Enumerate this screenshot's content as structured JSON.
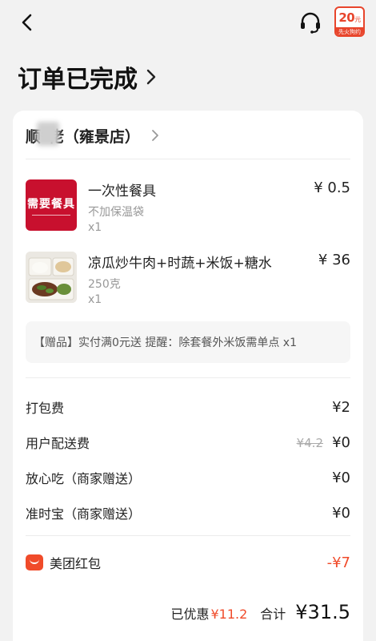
{
  "nav": {
    "back_icon": "chevron-left-icon",
    "service_icon": "headset-icon",
    "coupon": {
      "amount": "20",
      "unit": "元",
      "caption": "先火狗约"
    }
  },
  "status": {
    "title": "订单已完成"
  },
  "shop": {
    "name": "顺*佬（雍景店）"
  },
  "items": [
    {
      "name": "一次性餐具",
      "spec": "不加保温袋",
      "qty": "x1",
      "price": "¥ 0.5",
      "thumb_text": "需要餐具"
    },
    {
      "name": "凉瓜炒牛肉+时蔬+米饭+糖水",
      "spec": "250克",
      "qty": "x1",
      "price": "¥ 36"
    }
  ],
  "gift": {
    "text": "【赠品】实付满0元送 提醒：除套餐外米饭需单点 x1"
  },
  "fees": [
    {
      "label": "打包费",
      "value": "¥2"
    },
    {
      "label": "用户配送费",
      "original": "¥4.2",
      "value": "¥0"
    },
    {
      "label": "放心吃（商家赠送）",
      "value": "¥0"
    },
    {
      "label": "准时宝（商家赠送）",
      "value": "¥0"
    }
  ],
  "redpack": {
    "label": "美团红包",
    "value": "-¥7"
  },
  "summary": {
    "discount_label": "已优惠",
    "discount_value": "¥11.2",
    "total_label": "合计",
    "total_value": "¥31.5"
  },
  "colors": {
    "accent": "#f04b2a",
    "background": "#f2f2f2",
    "card": "#ffffff"
  }
}
